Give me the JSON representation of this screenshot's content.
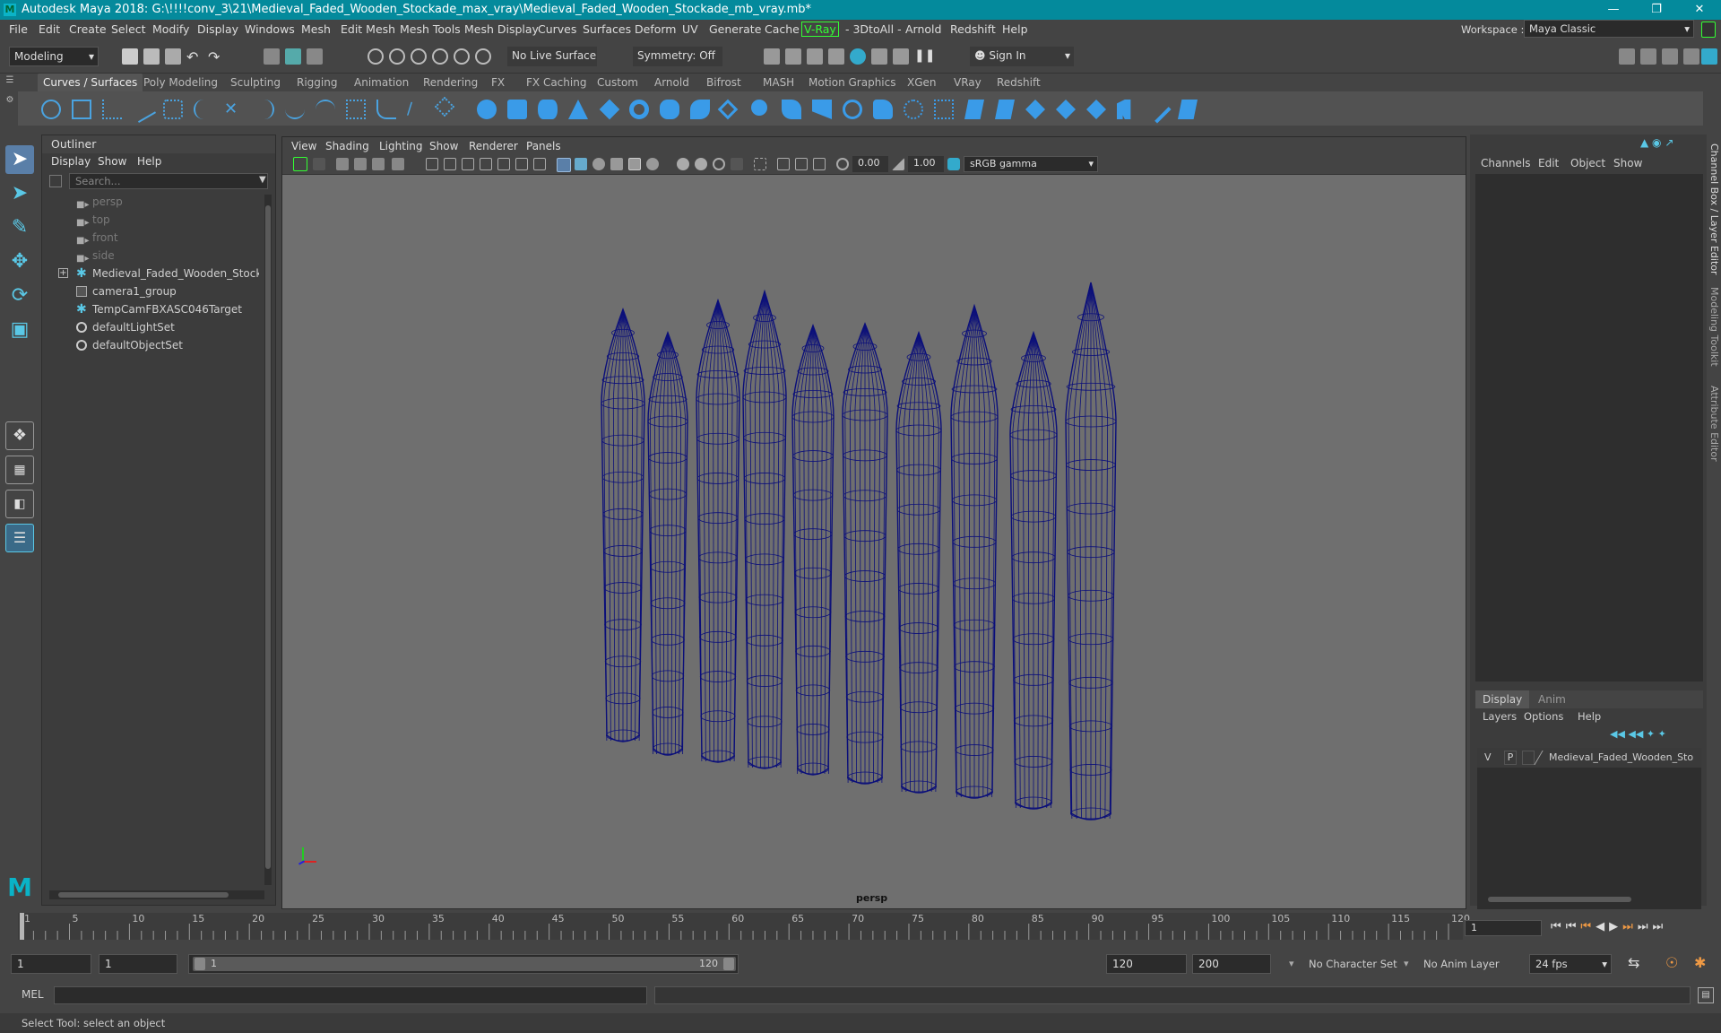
{
  "window": {
    "title": "Autodesk Maya 2018: G:\\!!!!conv_3\\21\\Medieval_Faded_Wooden_Stockade_max_vray\\Medieval_Faded_Wooden_Stockade_mb_vray.mb*"
  },
  "menubar": {
    "items": [
      "File",
      "Edit",
      "Create",
      "Select",
      "Modify",
      "Display",
      "Windows",
      "Mesh",
      "Edit Mesh",
      "Mesh Tools",
      "Mesh Display",
      "Curves",
      "Surfaces",
      "Deform",
      "UV",
      "Generate",
      "Cache",
      "V-Ray",
      "- 3DtoAll -",
      "Arnold",
      "Redshift",
      "Help"
    ],
    "workspace_label": "Workspace :",
    "workspace_value": "Maya Classic"
  },
  "statusline": {
    "mode": "Modeling",
    "live_surface": "No Live Surface",
    "symmetry": "Symmetry: Off",
    "sign_in": "Sign In"
  },
  "shelf": {
    "tabs": [
      "Curves / Surfaces",
      "Poly Modeling",
      "Sculpting",
      "Rigging",
      "Animation",
      "Rendering",
      "FX",
      "FX Caching",
      "Custom",
      "Arnold",
      "Bifrost",
      "MASH",
      "Motion Graphics",
      "XGen",
      "VRay",
      "Redshift"
    ],
    "active_tab": "Curves / Surfaces"
  },
  "outliner": {
    "title": "Outliner",
    "menu": [
      "Display",
      "Show",
      "Help"
    ],
    "search_placeholder": "Search...",
    "items": [
      {
        "label": "persp",
        "icon": "camera-icon",
        "dim": true
      },
      {
        "label": "top",
        "icon": "camera-icon",
        "dim": true
      },
      {
        "label": "front",
        "icon": "camera-icon",
        "dim": true
      },
      {
        "label": "side",
        "icon": "camera-icon",
        "dim": true
      },
      {
        "label": "Medieval_Faded_Wooden_Stockade_",
        "icon": "transform-icon",
        "dim": false,
        "expandable": true
      },
      {
        "label": "camera1_group",
        "icon": "group-icon",
        "dim": false
      },
      {
        "label": "TempCamFBXASC046Target",
        "icon": "transform-icon",
        "dim": false
      },
      {
        "label": "defaultLightSet",
        "icon": "set-icon",
        "dim": false
      },
      {
        "label": "defaultObjectSet",
        "icon": "set-icon",
        "dim": false
      }
    ]
  },
  "viewport": {
    "menu": [
      "View",
      "Shading",
      "Lighting",
      "Show",
      "Renderer",
      "Panels"
    ],
    "exposure": "0.00",
    "gamma": "1.00",
    "color_space": "sRGB gamma",
    "camera_label": "persp",
    "wire_color": "#0b0f7a"
  },
  "channelbox": {
    "menu": [
      "Channels",
      "Edit",
      "Object",
      "Show"
    ],
    "side_tabs": [
      "Channel Box / Layer Editor",
      "Modeling Toolkit",
      "Attribute Editor"
    ]
  },
  "layereditor": {
    "tabs": [
      "Display",
      "Anim"
    ],
    "menu": [
      "Layers",
      "Options",
      "Help"
    ],
    "layer": {
      "v": "V",
      "p": "P",
      "name": "Medieval_Faded_Wooden_Sto"
    }
  },
  "timeslider": {
    "ticks": [
      "1",
      "5",
      "10",
      "15",
      "20",
      "25",
      "30",
      "35",
      "40",
      "45",
      "50",
      "55",
      "60",
      "65",
      "70",
      "75",
      "80",
      "85",
      "90",
      "95",
      "100",
      "105",
      "110",
      "115",
      "120"
    ],
    "current_frame": "1"
  },
  "rangeslider": {
    "start": "1",
    "range_start": "1",
    "range_bar_start": "1",
    "range_bar_end": "120",
    "range_end": "120",
    "end": "200",
    "character_set": "No Character Set",
    "anim_layer": "No Anim Layer",
    "fps": "24 fps"
  },
  "commandline": {
    "language": "MEL"
  },
  "helpline": {
    "text": "Select Tool: select an object"
  }
}
